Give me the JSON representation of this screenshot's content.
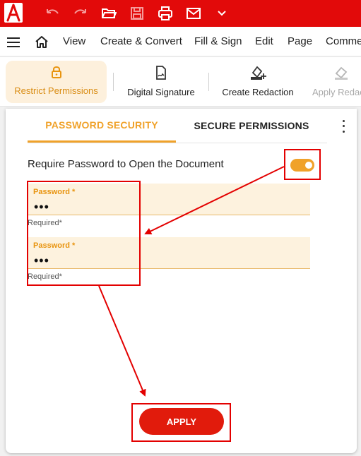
{
  "toolbar": {
    "icons": [
      "acrobat-logo-icon",
      "undo-icon",
      "redo-icon",
      "open-folder-icon",
      "save-icon",
      "print-icon",
      "mail-icon",
      "chevron-down-icon"
    ]
  },
  "menu": {
    "items": [
      "View",
      "Create & Convert",
      "Fill & Sign",
      "Edit",
      "Page",
      "Comme"
    ]
  },
  "ribbon": {
    "items": [
      {
        "label": "Restrict Permissions",
        "icon": "lock-icon",
        "state": "active"
      },
      {
        "label": "Digital Signature",
        "icon": "signature-icon",
        "state": "normal"
      },
      {
        "label": "Create Redaction",
        "icon": "redaction-icon",
        "state": "normal"
      },
      {
        "label": "Apply Redac",
        "icon": "eraser-icon",
        "state": "disabled"
      }
    ]
  },
  "panel": {
    "tabs": [
      "PASSWORD SECURITY",
      "SECURE PERMISSIONS"
    ],
    "active_tab": "PASSWORD SECURITY",
    "require_label": "Require Password to Open the Document",
    "require_enabled": true,
    "fields": [
      {
        "label": "Password *",
        "value": "•••",
        "helper": "Required*"
      },
      {
        "label": "Password *",
        "value": "•••",
        "helper": "Required*"
      }
    ],
    "apply_label": "APPLY"
  },
  "colors": {
    "brand_red": "#e20a0a",
    "accent_orange": "#f0a22a",
    "annotation_red": "#e30000"
  }
}
